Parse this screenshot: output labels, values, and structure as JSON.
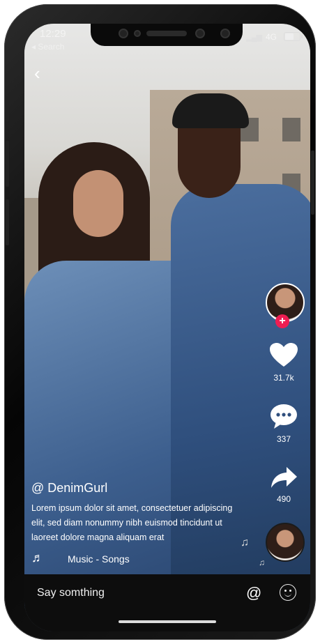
{
  "status_bar": {
    "time": "12:29",
    "back_app": "◂ Search",
    "network": "4G",
    "battery_level": 0.65
  },
  "video": {
    "username": "@ DenimGurl",
    "description": "Lorem ipsum dolor sit amet, consectetuer adipiscing elit, sed diam nonummy nibh euismod tincidunt ut laoreet dolore magna aliquam erat",
    "music": "Music - Songs"
  },
  "actions": {
    "likes": "31.7k",
    "comments": "337",
    "shares": "490"
  },
  "comment_bar": {
    "placeholder": "Say somthing"
  },
  "icons": {
    "back": "chevron-left-icon",
    "follow": "plus-icon",
    "like": "heart-icon",
    "comment": "speech-bubble-icon",
    "share": "share-arrow-icon",
    "music": "music-note-icon",
    "mention": "at-icon",
    "emoji": "smiley-icon"
  },
  "colors": {
    "follow_badge": "#ee1d52",
    "comment_bar": "#0d0d0d"
  }
}
